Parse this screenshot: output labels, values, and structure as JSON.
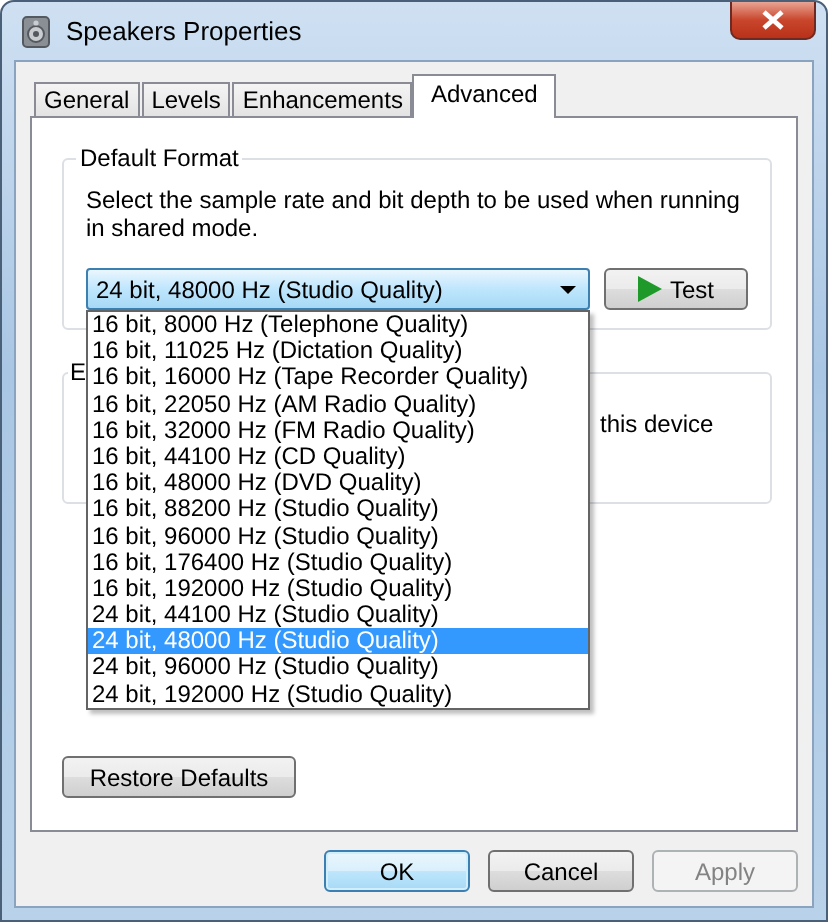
{
  "window": {
    "title": "Speakers Properties"
  },
  "tabs": [
    {
      "label": "General",
      "selected": false
    },
    {
      "label": "Levels",
      "selected": false
    },
    {
      "label": "Enhancements",
      "selected": false
    },
    {
      "label": "Advanced",
      "selected": true
    }
  ],
  "default_format": {
    "title": "Default Format",
    "description": "Select the sample rate and bit depth to be used when running in shared mode.",
    "format_dropdown": {
      "value": "24 bit, 48000 Hz (Studio Quality)",
      "expanded": true,
      "options": [
        {
          "label": "16 bit, 8000 Hz (Telephone Quality)",
          "selected": false
        },
        {
          "label": "16 bit, 11025 Hz (Dictation Quality)",
          "selected": false
        },
        {
          "label": "16 bit, 16000 Hz (Tape Recorder Quality)",
          "selected": false
        },
        {
          "label": "16 bit, 22050 Hz (AM Radio Quality)",
          "selected": false
        },
        {
          "label": "16 bit, 32000 Hz (FM Radio Quality)",
          "selected": false
        },
        {
          "label": "16 bit, 44100 Hz (CD Quality)",
          "selected": false
        },
        {
          "label": "16 bit, 48000 Hz (DVD Quality)",
          "selected": false
        },
        {
          "label": "16 bit, 88200 Hz (Studio Quality)",
          "selected": false
        },
        {
          "label": "16 bit, 96000 Hz (Studio Quality)",
          "selected": false
        },
        {
          "label": "16 bit, 176400 Hz (Studio Quality)",
          "selected": false
        },
        {
          "label": "16 bit, 192000 Hz (Studio Quality)",
          "selected": false
        },
        {
          "label": "24 bit, 44100 Hz (Studio Quality)",
          "selected": false
        },
        {
          "label": "24 bit, 48000 Hz (Studio Quality)",
          "selected": true
        },
        {
          "label": "24 bit, 96000 Hz (Studio Quality)",
          "selected": false
        },
        {
          "label": "24 bit, 192000 Hz (Studio Quality)",
          "selected": false
        }
      ]
    },
    "test_button": "Test"
  },
  "second_group": {
    "title": "E",
    "text": "this device"
  },
  "restore_defaults_button": "Restore Defaults",
  "buttons": [
    {
      "label": "OK",
      "default": true,
      "disabled": false
    },
    {
      "label": "Cancel",
      "default": false,
      "disabled": false
    },
    {
      "label": "Apply",
      "default": false,
      "disabled": true
    }
  ]
}
